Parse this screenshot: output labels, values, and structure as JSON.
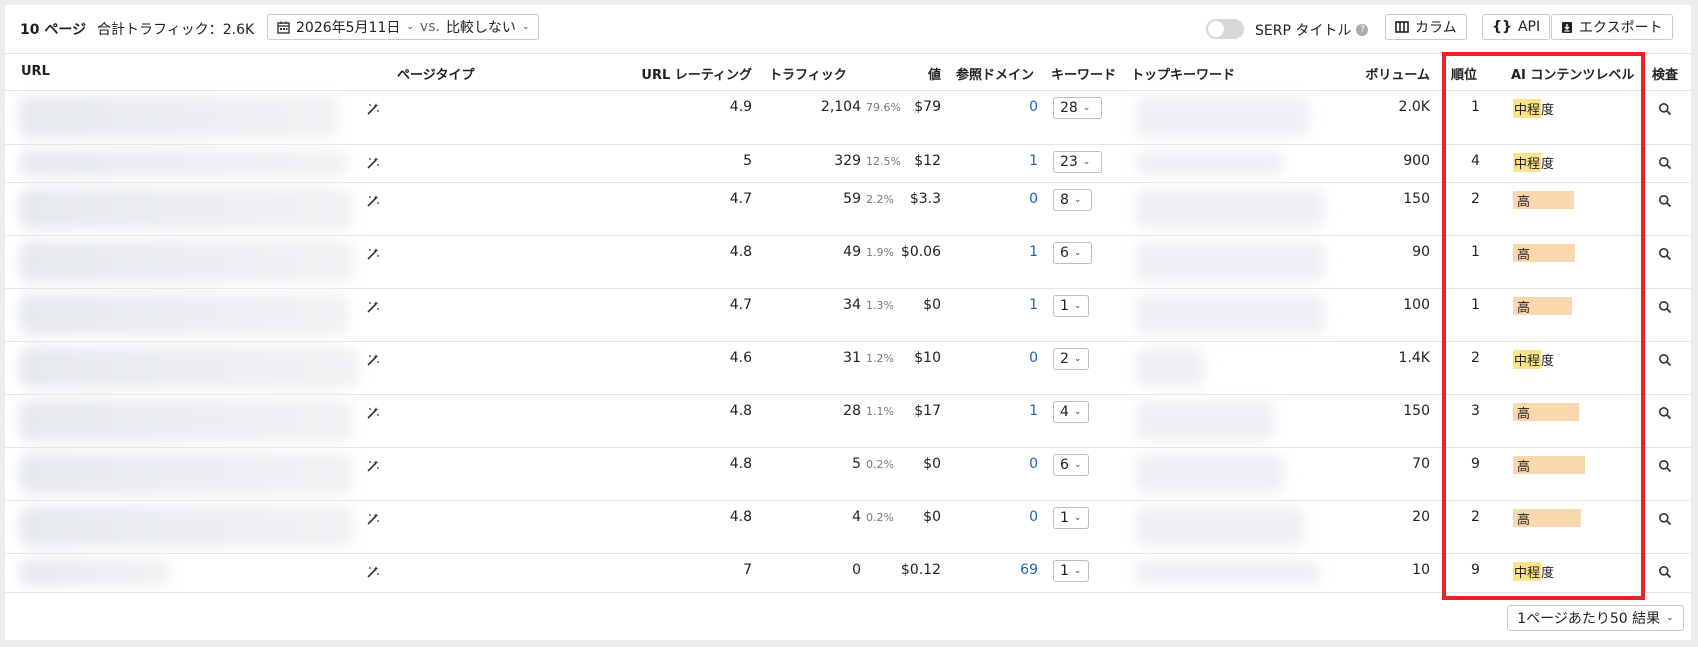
{
  "header": {
    "pages_label": "10 ページ",
    "traffic_total": "合計トラフィック：2.6K",
    "date": "2026年5月11日",
    "vs": "vs.",
    "compare": "比較しない",
    "serp_title": "SERP タイトル",
    "columns_btn": "カラム",
    "api_btn": "API",
    "export_btn": "エクスポート"
  },
  "columns": {
    "url": "URL",
    "page_type": "ページタイプ",
    "url_rating": "URL レーティング",
    "traffic": "トラフィック",
    "value": "値",
    "ref_domains": "参照ドメイン",
    "keywords": "キーワード",
    "top_keyword": "トップキーワード",
    "volume": "ボリューム",
    "position": "順位",
    "ai_level": "AI コンテンツレベル",
    "inspect": "検査"
  },
  "rows": [
    {
      "ur": "4.9",
      "traffic": "2,104",
      "pct": "79.6%",
      "value": "$79",
      "rd": "0",
      "kw": "28",
      "volume": "2.0K",
      "pos": "1",
      "ai": "mid",
      "ai_a": "中程",
      "ai_b": "度"
    },
    {
      "ur": "5",
      "traffic": "329",
      "pct": "12.5%",
      "value": "$12",
      "rd": "1",
      "kw": "23",
      "volume": "900",
      "pos": "4",
      "ai": "mid",
      "ai_a": "中程",
      "ai_b": "度"
    },
    {
      "ur": "4.7",
      "traffic": "59",
      "pct": "2.2%",
      "value": "$3.3",
      "rd": "0",
      "kw": "8",
      "volume": "150",
      "pos": "2",
      "ai": "high",
      "ai_a": "高",
      "ai_b": ""
    },
    {
      "ur": "4.8",
      "traffic": "49",
      "pct": "1.9%",
      "value": "$0.06",
      "rd": "1",
      "kw": "6",
      "volume": "90",
      "pos": "1",
      "ai": "high",
      "ai_a": "高",
      "ai_b": ""
    },
    {
      "ur": "4.7",
      "traffic": "34",
      "pct": "1.3%",
      "value": "$0",
      "rd": "1",
      "kw": "1",
      "volume": "100",
      "pos": "1",
      "ai": "high",
      "ai_a": "高",
      "ai_b": ""
    },
    {
      "ur": "4.6",
      "traffic": "31",
      "pct": "1.2%",
      "value": "$10",
      "rd": "0",
      "kw": "2",
      "volume": "1.4K",
      "pos": "2",
      "ai": "mid",
      "ai_a": "中程",
      "ai_b": "度"
    },
    {
      "ur": "4.8",
      "traffic": "28",
      "pct": "1.1%",
      "value": "$17",
      "rd": "1",
      "kw": "4",
      "volume": "150",
      "pos": "3",
      "ai": "high",
      "ai_a": "高",
      "ai_b": ""
    },
    {
      "ur": "4.8",
      "traffic": "5",
      "pct": "0.2%",
      "value": "$0",
      "rd": "0",
      "kw": "6",
      "volume": "70",
      "pos": "9",
      "ai": "high",
      "ai_a": "高",
      "ai_b": ""
    },
    {
      "ur": "4.8",
      "traffic": "4",
      "pct": "0.2%",
      "value": "$0",
      "rd": "0",
      "kw": "1",
      "volume": "20",
      "pos": "2",
      "ai": "high",
      "ai_a": "高",
      "ai_b": ""
    },
    {
      "ur": "7",
      "traffic": "0",
      "pct": "",
      "value": "$0.12",
      "rd": "69",
      "kw": "1",
      "volume": "10",
      "pos": "9",
      "ai": "mid",
      "ai_a": "中程",
      "ai_b": "度"
    }
  ],
  "footer": {
    "per_page": "1ページあたり50 結果"
  },
  "colors": {
    "highlight_box": "#e8232a",
    "level_mid": "#fbe38a",
    "level_high": "#fbd7ad",
    "link": "#1a63b6"
  }
}
